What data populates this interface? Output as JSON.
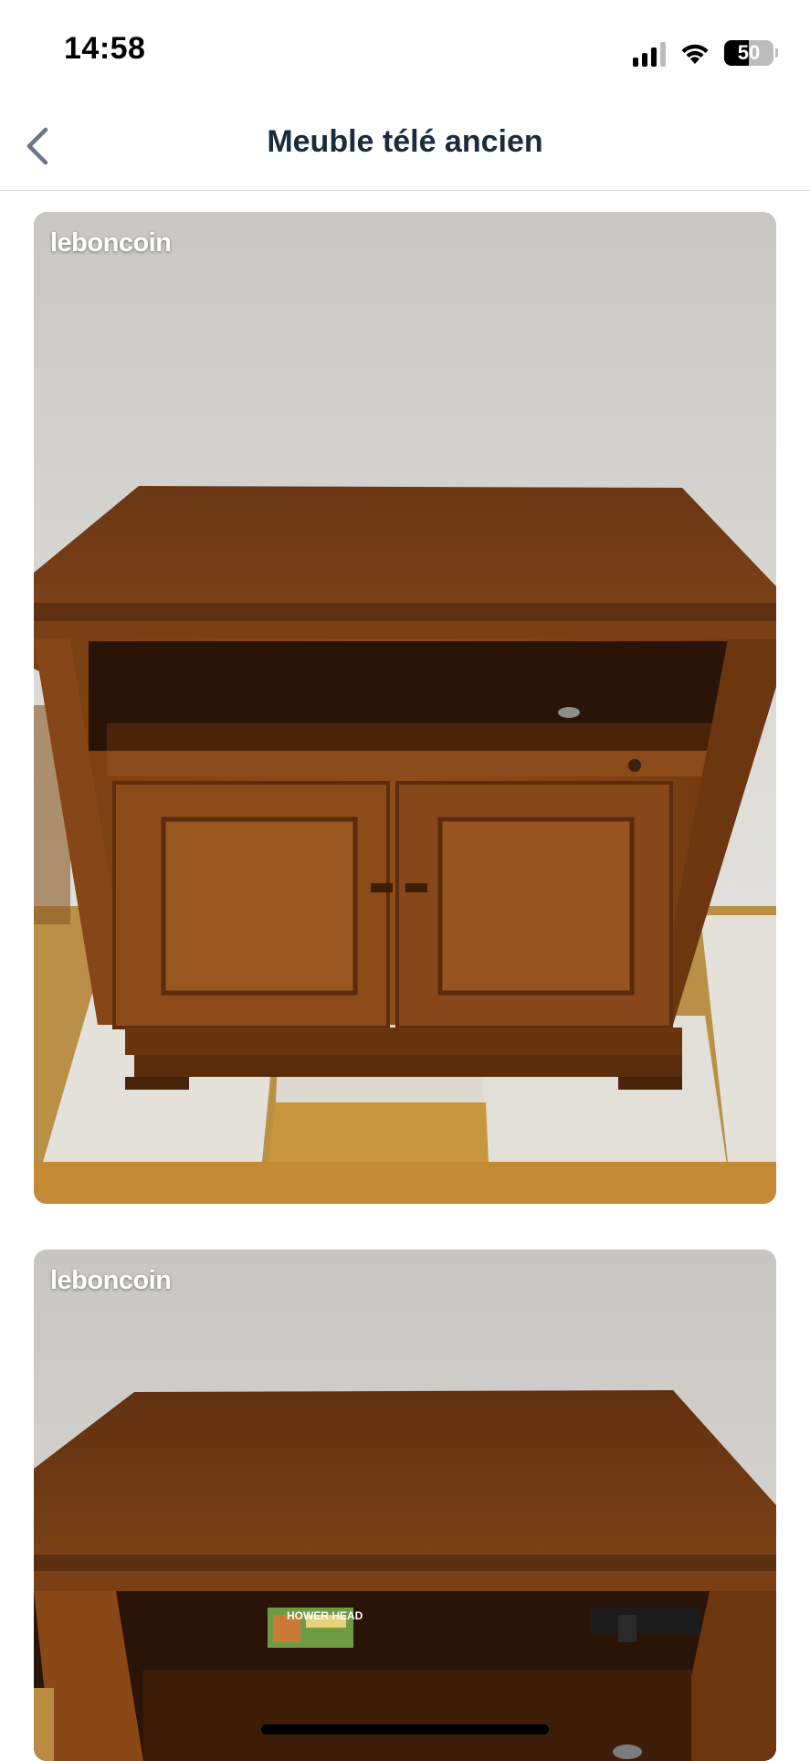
{
  "status_bar": {
    "time": "14:58",
    "battery_level": "50",
    "signal_bars": 3,
    "icons": [
      "cellular-signal-icon",
      "wifi-icon",
      "battery-icon"
    ]
  },
  "nav": {
    "title": "Meuble télé ancien",
    "back_icon": "chevron-left-icon"
  },
  "gallery": {
    "photos": [
      {
        "watermark": "leboncoin"
      },
      {
        "watermark": "leboncoin",
        "book_text": "HOWER HEAD"
      }
    ]
  },
  "colors": {
    "title_text": "#1a2b3c",
    "wood": "#7a3f14",
    "wall": "#d8d6d2"
  }
}
